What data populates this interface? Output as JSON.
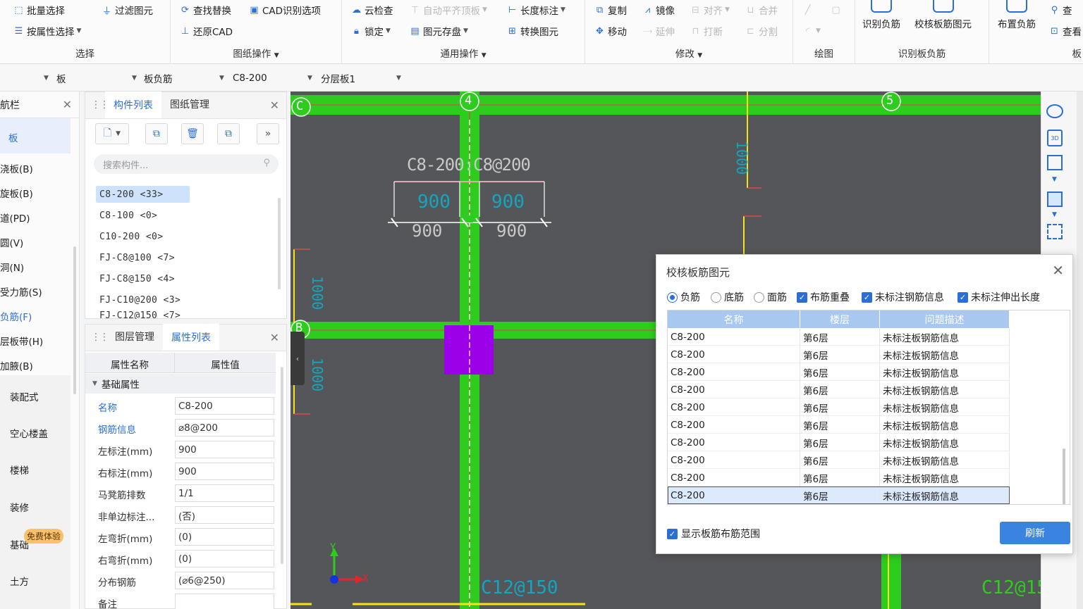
{
  "ribbon": {
    "select": {
      "batch_select": "批量选择",
      "filter_elements": "过滤图元",
      "attr_select": "按属性选择",
      "title": "选择"
    },
    "drawing_ops": {
      "find_replace": "查找替换",
      "cad_options": "CAD识别选项",
      "restore_cad": "还原CAD",
      "title": "图纸操作"
    },
    "general_ops": {
      "cloud_check": "云检查",
      "auto_align": "自动平齐顶板",
      "length_mark": "长度标注",
      "lock": "锁定",
      "save_elements": "图元存盘",
      "convert_elements": "转换图元",
      "title": "通用操作"
    },
    "modify": {
      "copy": "复制",
      "mirror": "镜像",
      "align": "对齐",
      "merge": "合并",
      "move": "移动",
      "extend": "延伸",
      "break": "打断",
      "split": "分割",
      "title": "修改"
    },
    "draw": {
      "title": "绘图"
    },
    "recognize": {
      "identify_neg": "识别负筋",
      "check_elements": "校核板筋图元",
      "title": "识别板负筋"
    },
    "arrange": {
      "place_neg": "布置负筋",
      "query1": "查",
      "query2": "查看",
      "title": "板"
    }
  },
  "selectors": {
    "s1": "板",
    "s2": "板负筋",
    "s3": "C8-200",
    "s4": "分层板1"
  },
  "nav": {
    "header": "航栏",
    "items": [
      "板",
      "浇板(B)",
      "旋板(B)",
      "道(PD)",
      "圆(V)",
      "洞(N)",
      "受力筋(S)",
      "负筋(F)",
      "层板带(H)",
      "加腋(B)",
      "装配式",
      "空心楼盖",
      "楼梯",
      "装修",
      "基础",
      "土方"
    ],
    "free_trial": "免费体验"
  },
  "component_panel": {
    "tab_list": "构件列表",
    "tab_drawing": "图纸管理",
    "search_placeholder": "搜索构件...",
    "items": [
      "C8-200 <33>",
      "C8-100 <0>",
      "C10-200 <0>",
      "FJ-C8@100 <7>",
      "FJ-C8@150 <4>",
      "FJ-C10@200 <3>",
      "FJ-C12@150 <7>"
    ]
  },
  "property_panel": {
    "tab_layer": "图层管理",
    "tab_props": "属性列表",
    "col_name": "属性名称",
    "col_value": "属性值",
    "section": "基础属性",
    "rows": [
      {
        "name": "名称",
        "value": "C8-200",
        "blue": true
      },
      {
        "name": "钢筋信息",
        "value": "⌀8@200",
        "blue": true
      },
      {
        "name": "左标注(mm)",
        "value": "900"
      },
      {
        "name": "右标注(mm)",
        "value": "900"
      },
      {
        "name": "马凳筋排数",
        "value": "1/1"
      },
      {
        "name": "非单边标注...",
        "value": "(否)"
      },
      {
        "name": "左弯折(mm)",
        "value": "(0)"
      },
      {
        "name": "右弯折(mm)",
        "value": "(0)"
      },
      {
        "name": "分布钢筋",
        "value": "(⌀6@250)"
      },
      {
        "name": "备注",
        "value": ""
      }
    ]
  },
  "canvas": {
    "axis_c": "C",
    "axis_b": "B",
    "axis_4": "4",
    "axis_5": "5",
    "rebar_label": "C8-200:C8@200",
    "dim_900": "900",
    "dim_1000": "1000",
    "label_c12": "C12@150",
    "axis_x": "X",
    "axis_y": "Y"
  },
  "dialog": {
    "title": "校核板筋图元",
    "radio_neg": "负筋",
    "radio_bottom": "底筋",
    "radio_face": "面筋",
    "chk_overlap": "布筋重叠",
    "chk_unmarked": "未标注钢筋信息",
    "chk_extend": "未标注伸出长度",
    "col_name": "名称",
    "col_floor": "楼层",
    "col_desc": "问题描述",
    "rows": [
      {
        "name": "C8-200",
        "floor": "第6层",
        "desc": "未标注板钢筋信息"
      },
      {
        "name": "C8-200",
        "floor": "第6层",
        "desc": "未标注板钢筋信息"
      },
      {
        "name": "C8-200",
        "floor": "第6层",
        "desc": "未标注板钢筋信息"
      },
      {
        "name": "C8-200",
        "floor": "第6层",
        "desc": "未标注板钢筋信息"
      },
      {
        "name": "C8-200",
        "floor": "第6层",
        "desc": "未标注板钢筋信息"
      },
      {
        "name": "C8-200",
        "floor": "第6层",
        "desc": "未标注板钢筋信息"
      },
      {
        "name": "C8-200",
        "floor": "第6层",
        "desc": "未标注板钢筋信息"
      },
      {
        "name": "C8-200",
        "floor": "第6层",
        "desc": "未标注板钢筋信息"
      },
      {
        "name": "C8-200",
        "floor": "第6层",
        "desc": "未标注板钢筋信息"
      },
      {
        "name": "C8-200",
        "floor": "第6层",
        "desc": "未标注板钢筋信息"
      }
    ],
    "show_range": "显示板筋布筋范围",
    "refresh": "刷新"
  },
  "colors": {
    "accent": "#2b6fd6",
    "beam_green": "#2ecc1e",
    "canvas_bg": "#555659",
    "slab_purple": "#9b00e8"
  }
}
